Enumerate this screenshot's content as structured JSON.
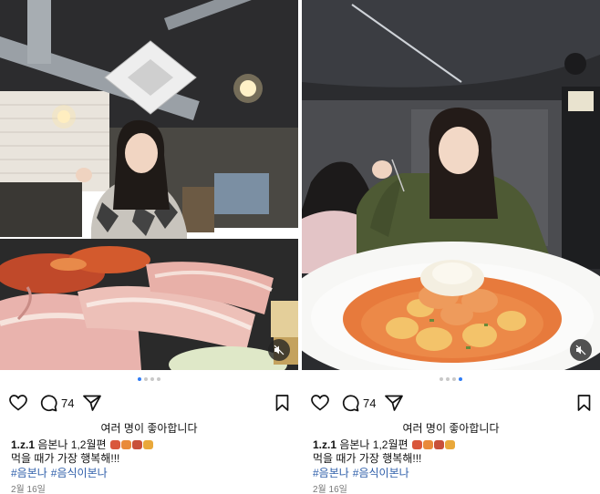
{
  "posts": [
    {
      "comment_count": "74",
      "likes_text": "여러 명이 좋아합니다",
      "username": "1.z.1",
      "caption_line1": " 음본나 1,2월편",
      "caption_line2": "먹을 때가 가장 행복해!!!",
      "hashtags": [
        "#음본나",
        "#음식이본나"
      ],
      "date": "2월 16일",
      "carousel": {
        "count": 4,
        "active_index": 0
      },
      "emojis": [
        "bacon",
        "sushi-tray",
        "bacon",
        "beer"
      ],
      "photo_icon": "mute-icon"
    },
    {
      "comment_count": "74",
      "likes_text": "여러 명이 좋아합니다",
      "username": "1.z.1",
      "caption_line1": " 음본나 1,2월편",
      "caption_line2": "먹을 때가 가장 행복해!!!",
      "hashtags": [
        "#음본나",
        "#음식이본나"
      ],
      "date": "2월 16일",
      "carousel": {
        "count": 4,
        "active_index": 3
      },
      "emojis": [
        "bacon",
        "sushi-tray",
        "bacon",
        "beer"
      ],
      "photo_icon": "mute-icon"
    }
  ],
  "colors": {
    "accent_blue": "#2f7cf6",
    "hashtag": "#2f5faa",
    "inactive_dot": "#c8c8c8"
  }
}
